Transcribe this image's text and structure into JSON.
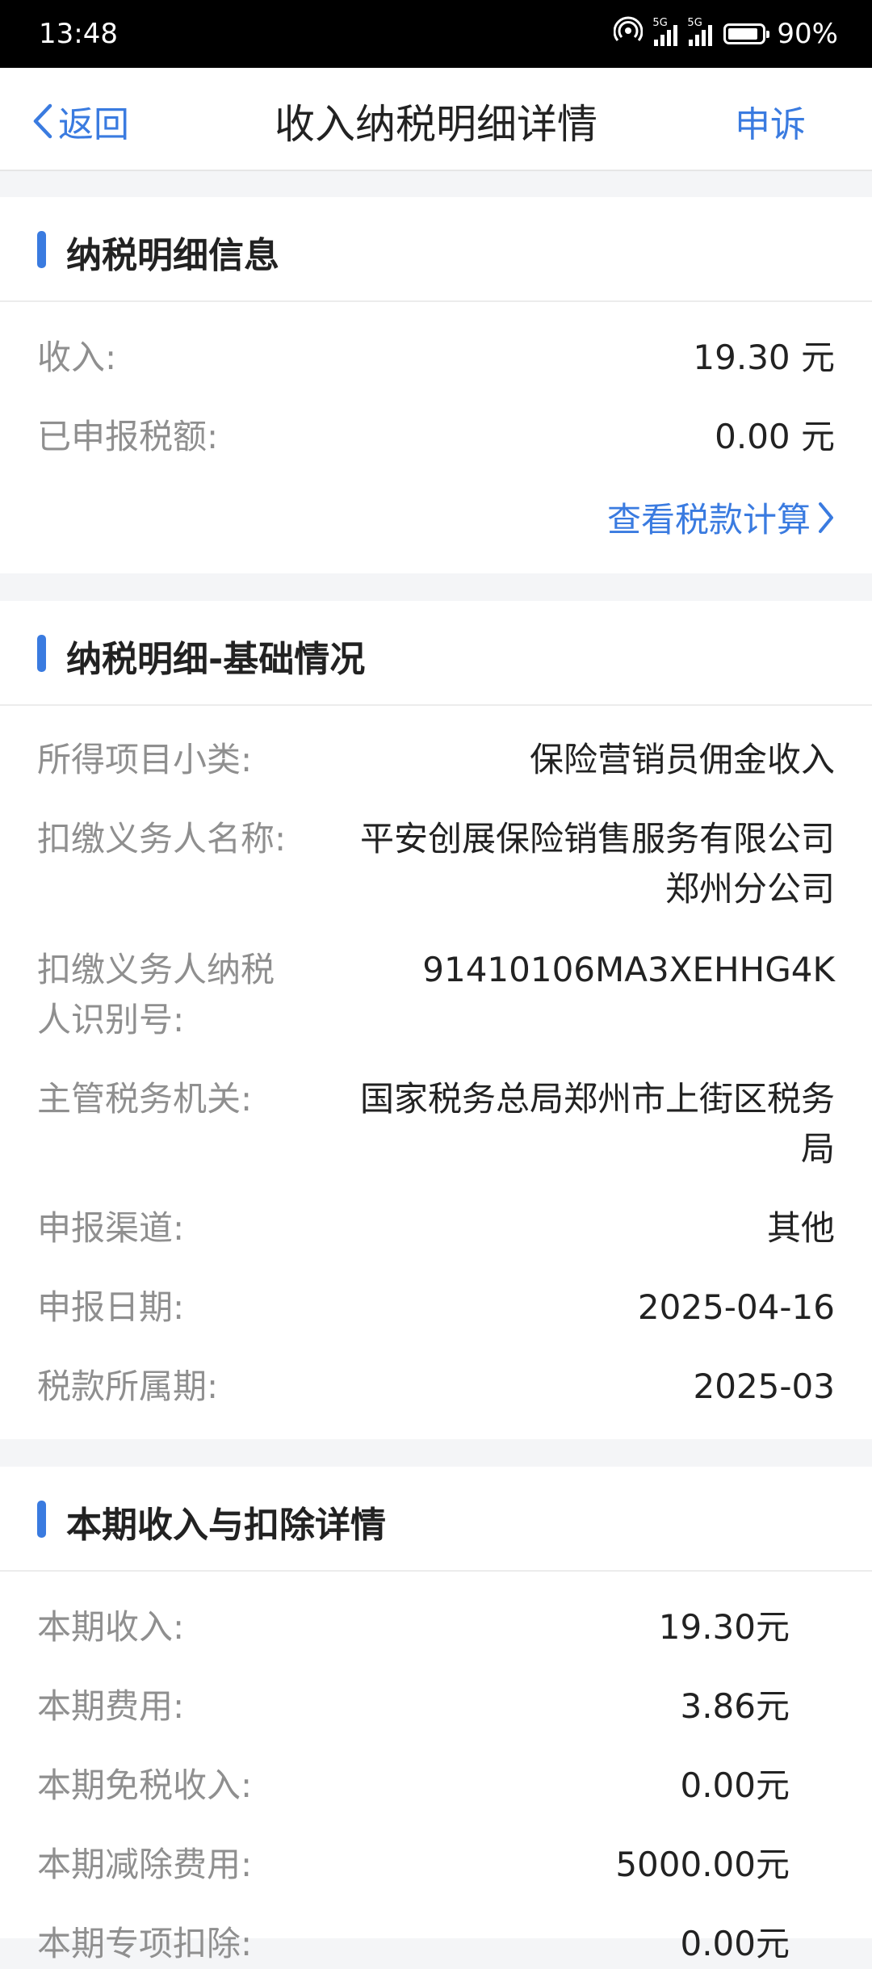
{
  "status_bar": {
    "time": "13:48",
    "battery": "90%",
    "sig1_tag": "5G",
    "sig2_tag": "5G"
  },
  "nav": {
    "back_label": "返回",
    "title": "收入纳税明细详情",
    "appeal_label": "申诉"
  },
  "section1": {
    "title": "纳税明细信息",
    "rows": [
      {
        "label": "收入:",
        "value": "19.30 元"
      },
      {
        "label": "已申报税额:",
        "value": "0.00 元"
      }
    ],
    "link": "查看税款计算"
  },
  "section2": {
    "title": "纳税明细-基础情况",
    "rows": [
      {
        "label": "所得项目小类:",
        "value": "保险营销员佣金收入"
      },
      {
        "label": "扣缴义务人名称:",
        "value": "平安创展保险销售服务有限公司郑州分公司"
      },
      {
        "label": "扣缴义务人纳税人识别号:",
        "value": "91410106MA3XEHHG4K"
      },
      {
        "label": "主管税务机关:",
        "value": "国家税务总局郑州市上街区税务局"
      },
      {
        "label": "申报渠道:",
        "value": "其他"
      },
      {
        "label": "申报日期:",
        "value": "2025-04-16"
      },
      {
        "label": "税款所属期:",
        "value": "2025-03"
      }
    ]
  },
  "section3": {
    "title": "本期收入与扣除详情",
    "rows": [
      {
        "label": "本期收入:",
        "value": "19.30元"
      },
      {
        "label": "本期费用:",
        "value": "3.86元"
      },
      {
        "label": "本期免税收入:",
        "value": "0.00元"
      },
      {
        "label": "本期减除费用:",
        "value": "5000.00元"
      },
      {
        "label": "本期专项扣除:",
        "value": "0.00元"
      }
    ]
  },
  "colors": {
    "accent": "#3a7be0",
    "label_gray": "#8f8f8f",
    "page_bg": "#f4f5f7"
  }
}
